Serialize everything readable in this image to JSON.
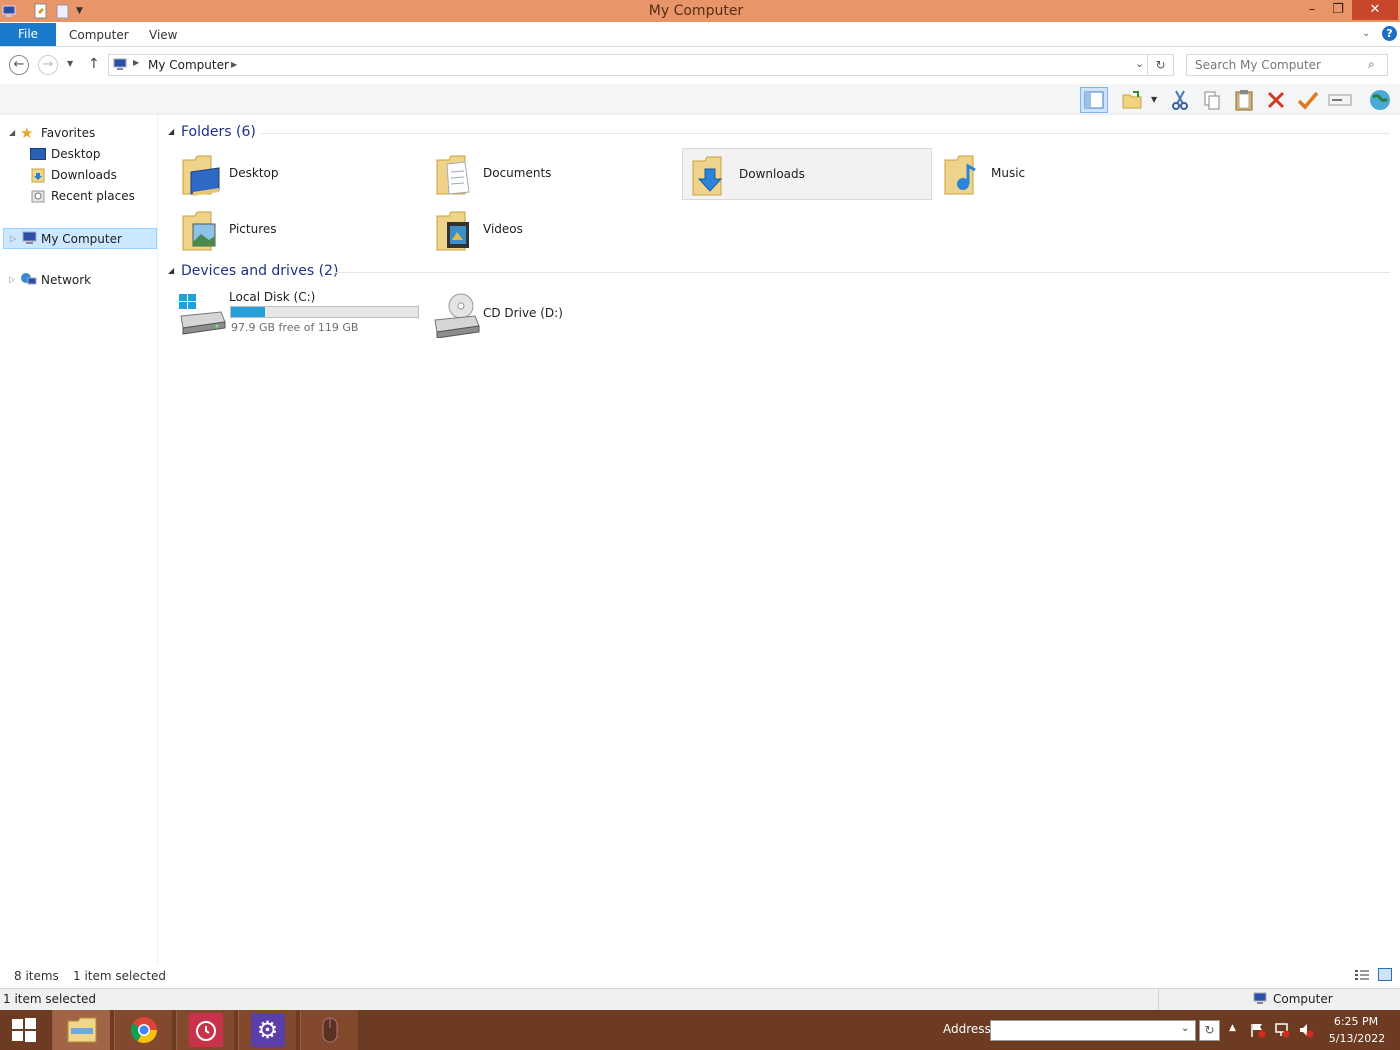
{
  "window": {
    "title": "My Computer"
  },
  "ribbon": {
    "tabs": [
      "File",
      "Computer",
      "View"
    ]
  },
  "address": {
    "location": "My Computer",
    "search_placeholder": "Search My Computer"
  },
  "nav": {
    "favorites": "Favorites",
    "favorite_items": [
      "Desktop",
      "Downloads",
      "Recent places"
    ],
    "my_computer": "My Computer",
    "network": "Network"
  },
  "content": {
    "folders_header": "Folders (6)",
    "folders": [
      "Desktop",
      "Documents",
      "Downloads",
      "Music",
      "Pictures",
      "Videos"
    ],
    "selected_folder": "Downloads",
    "drives_header": "Devices and drives (2)",
    "drives": [
      {
        "name": "Local Disk (C:)",
        "free_text": "97.9 GB free of 119 GB",
        "used_fraction": 0.18
      },
      {
        "name": "CD Drive (D:)"
      }
    ]
  },
  "status": {
    "items": "8 items",
    "selected": "1 item selected",
    "bottom_left": "1 item selected",
    "bottom_right": "Computer"
  },
  "taskbar": {
    "address_label": "Address",
    "time": "6:25 PM",
    "date": "5/13/2022"
  },
  "colors": {
    "titlebar": "#e8956a",
    "close": "#c8462a",
    "file_tab": "#1979ca",
    "taskbar": "#6d3a22",
    "accent": "#1e3287",
    "drive_bar": "#26a0da"
  }
}
